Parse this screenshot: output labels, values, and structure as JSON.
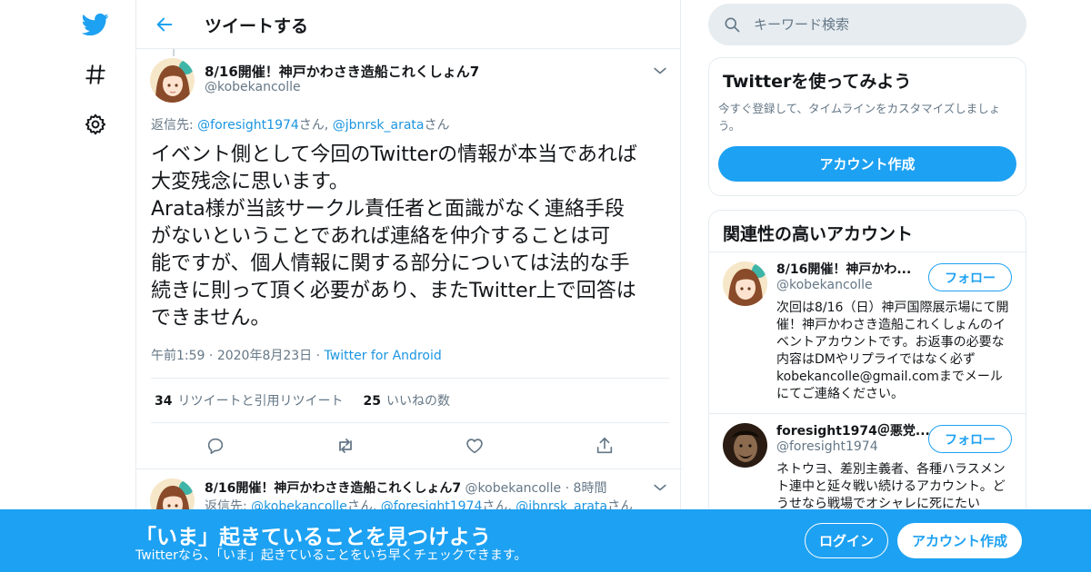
{
  "colors": {
    "brand": "#1da1f2",
    "link": "#1b95e0",
    "text": "#14171a",
    "muted": "#657786",
    "border": "#e6ecf0"
  },
  "nav": {
    "icons": [
      "twitter-logo-icon",
      "hashtag-icon",
      "gear-icon"
    ]
  },
  "header": {
    "title": "ツイートする"
  },
  "tweet": {
    "author_name": "8/16開催！神戸かわさき造船これくしょん7",
    "author_handle": "@kobekancolle",
    "reply_prefix": "返信先: ",
    "reply_to_1": "@foresight1974",
    "reply_sep_1": "さん, ",
    "reply_to_2": "@jbnrsk_arata",
    "reply_suffix": "さん",
    "text": "イベント側として今回のTwitterの情報が本当であれば\n大変残念に思います。\nArata様が当該サークル責任者と面識がなく連絡手段\nがないということであれば連絡を仲介することは可\n能ですが、個人情報に関する部分については法的な手\n続きに則って頂く必要があり、またTwitter上で回答は\nできません。",
    "time": "午前1:59",
    "date": "2020年8月23日",
    "source": "Twitter for Android",
    "retweet_count": "34",
    "retweet_label": "リツイートと引用リツイート",
    "like_count": "25",
    "like_label": "いいねの数"
  },
  "reply_tweet": {
    "author_name": "8/16開催！神戸かわさき造船これくしょん7",
    "author_handle": "@kobekancolle",
    "age": "8時間",
    "reply_prefix": "返信先: ",
    "reply_to_1": "@kobekancolle",
    "reply_sep_1": "さん, ",
    "reply_to_2": "@foresight1974",
    "reply_sep_2": "さん, ",
    "reply_to_3": "@jbnrsk_arata",
    "reply_suffix": "さん"
  },
  "search": {
    "placeholder": "キーワード検索"
  },
  "signup_card": {
    "title": "Twitterを使ってみよう",
    "desc": "今すぐ登録して、タイムラインをカスタマイズしましょう。",
    "button": "アカウント作成"
  },
  "related": {
    "title": "関連性の高いアカウント",
    "follow_label": "フォロー",
    "accounts": [
      {
        "name": "8/16開催！神戸かわ...",
        "handle": "@kobekancolle",
        "bio": "次回は8/16（日）神戸国際展示場にて開催！神戸かわさき造船これくしょんのイベントアカウントです。お返事の必要な内容はDMやリプライではなく必ず kobekancolle@gmail.comまでメールにてご連絡ください。"
      },
      {
        "name": "foresight1974＠悪党...",
        "handle": "@foresight1974",
        "bio": "ネトウヨ、差別主義者、各種ハラスメント連中と延々戦い続けるアカウント。どうせなら戦場でオシャレに死にたい"
      }
    ]
  },
  "banner": {
    "title": "「いま」起きていることを見つけよう",
    "subtitle": "Twitterなら、「いま」起きていることをいち早くチェックできます。",
    "login": "ログイン",
    "signup": "アカウント作成"
  }
}
